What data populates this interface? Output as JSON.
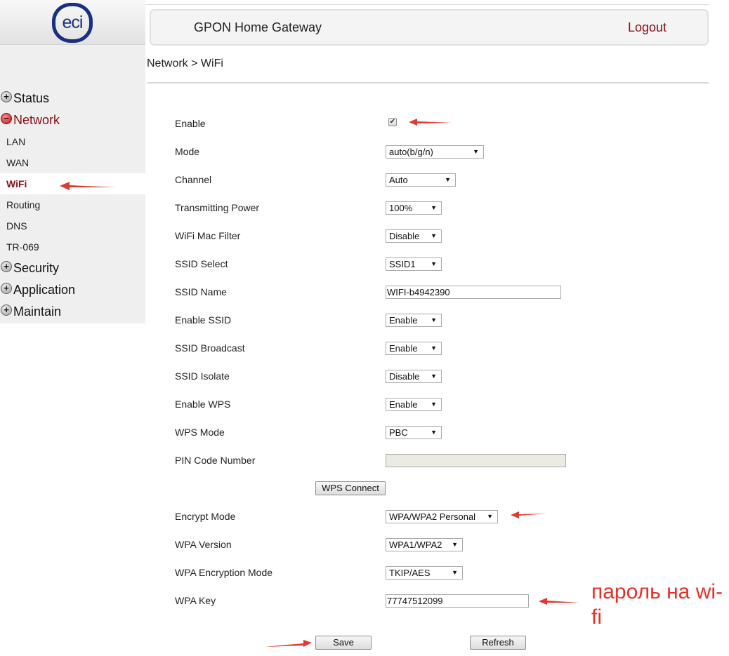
{
  "logo": {
    "text": "eci"
  },
  "header": {
    "title": "GPON Home Gateway",
    "logout_label": "Logout"
  },
  "breadcrumb": "Network > WiFi",
  "sidebar": {
    "groups": [
      {
        "label": "Status",
        "icon": "plus-circle-icon",
        "expanded": false
      },
      {
        "label": "Network",
        "icon": "minus-circle-icon",
        "expanded": true,
        "items": [
          {
            "label": "LAN",
            "active": false
          },
          {
            "label": "WAN",
            "active": false
          },
          {
            "label": "WiFi",
            "active": true
          },
          {
            "label": "Routing",
            "active": false
          },
          {
            "label": "DNS",
            "active": false
          },
          {
            "label": "TR-069",
            "active": false
          }
        ]
      },
      {
        "label": "Security",
        "icon": "plus-circle-icon",
        "expanded": false
      },
      {
        "label": "Application",
        "icon": "plus-circle-icon",
        "expanded": false
      },
      {
        "label": "Maintain",
        "icon": "plus-circle-icon",
        "expanded": false
      }
    ]
  },
  "form": {
    "enable": {
      "label": "Enable",
      "checked": true,
      "check_glyph": "✔"
    },
    "mode": {
      "label": "Mode",
      "value": "auto(b/g/n)"
    },
    "channel": {
      "label": "Channel",
      "value": "Auto"
    },
    "tx_power": {
      "label": "Transmitting Power",
      "value": "100%"
    },
    "mac_filter": {
      "label": "WiFi Mac Filter",
      "value": "Disable"
    },
    "ssid_select": {
      "label": "SSID Select",
      "value": "SSID1"
    },
    "ssid_name": {
      "label": "SSID Name",
      "value": "WIFI-b4942390"
    },
    "enable_ssid": {
      "label": "Enable SSID",
      "value": "Enable"
    },
    "ssid_broadcast": {
      "label": "SSID Broadcast",
      "value": "Enable"
    },
    "ssid_isolate": {
      "label": "SSID Isolate",
      "value": "Disable"
    },
    "enable_wps": {
      "label": "Enable WPS",
      "value": "Enable"
    },
    "wps_mode": {
      "label": "WPS Mode",
      "value": "PBC"
    },
    "pin_code": {
      "label": "PIN Code Number",
      "value": ""
    },
    "wps_connect_label": "WPS Connect",
    "encrypt_mode": {
      "label": "Encrypt Mode",
      "value": "WPA/WPA2 Personal"
    },
    "wpa_version": {
      "label": "WPA Version",
      "value": "WPA1/WPA2"
    },
    "wpa_enc_mode": {
      "label": "WPA Encryption Mode",
      "value": "TKIP/AES"
    },
    "wpa_key": {
      "label": "WPA Key",
      "value": "77747512099"
    },
    "save_label": "Save",
    "refresh_label": "Refresh",
    "dropdown_glyph": "▼"
  },
  "annotation": {
    "text": "пароль на wi-fi",
    "color": "#e8302a"
  }
}
